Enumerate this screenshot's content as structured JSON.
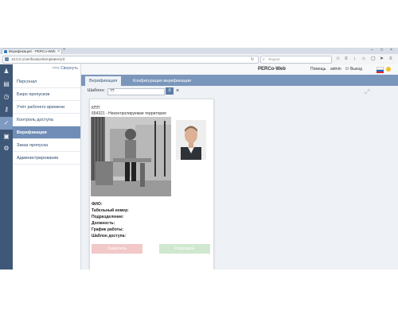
{
  "browser": {
    "tab_title": "Верификация - PERCo-Web",
    "tab_close": "×",
    "new_tab": "+",
    "url": "10.0.0.1/verification/templates/1/3",
    "search_placeholder": "Яндекс",
    "window_controls": {
      "minimize": "–",
      "maximize": "□",
      "close": "×"
    }
  },
  "sidebar": {
    "collapse_label": "<<< Свернуть",
    "items": [
      {
        "label": "Персонал",
        "icon": "person-icon"
      },
      {
        "label": "Бюро пропусков",
        "icon": "id-card-icon"
      },
      {
        "label": "Учёт рабочего времени",
        "icon": "clock-icon"
      },
      {
        "label": "Контроль доступа",
        "icon": "key-icon"
      },
      {
        "label": "Верификация",
        "icon": "verification-icon",
        "active": true
      },
      {
        "label": "Заказ пропуска",
        "icon": "pass-order-icon"
      },
      {
        "label": "Администрирование",
        "icon": "gear-icon"
      }
    ]
  },
  "header": {
    "brand": "PERCo-Web",
    "help": "Помощь",
    "user": "admin",
    "logout": "Выход"
  },
  "tabs": [
    {
      "label": "Верификация",
      "active": true
    },
    {
      "label": "Конфигурация верификации",
      "active": false
    }
  ],
  "template": {
    "label": "Шаблон:",
    "value": "??"
  },
  "card": {
    "device": "КПП",
    "zone": "654321 - Неконтролируемая территория",
    "fields": [
      "ФИО:",
      "Табельный номер:",
      "Подразделение:",
      "Должность:",
      "График работы:",
      "Шаблон доступа:"
    ],
    "deny_label": "Запретить",
    "allow_label": "Разрешить"
  }
}
